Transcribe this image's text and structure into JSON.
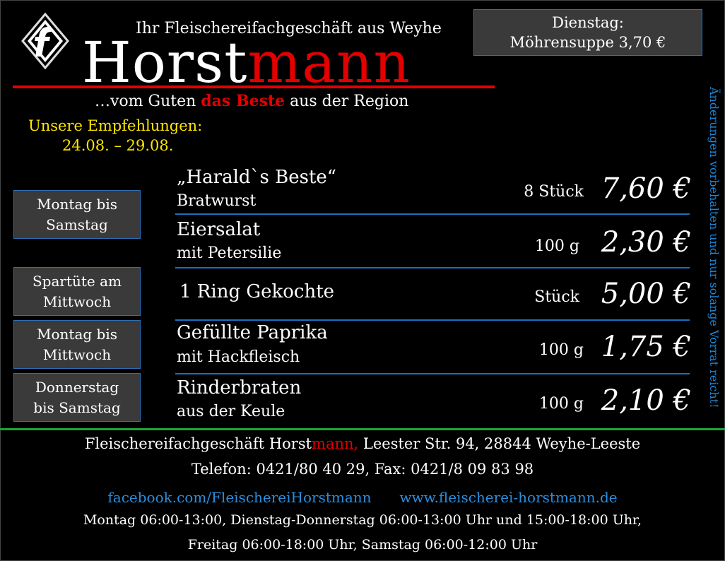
{
  "logo": {
    "icon": "fleischerei-f-logo"
  },
  "header": {
    "tagline": "Ihr Fleischereifachgeschäft aus Weyhe",
    "brand_white": "Horst",
    "brand_red": "mann",
    "slogan_pre": "…vom Guten ",
    "slogan_bold": "das Beste",
    "slogan_post": " aus der Region"
  },
  "recommendations": {
    "title": "Unsere Empfehlungen:",
    "dates": "24.08. – 29.08."
  },
  "special": {
    "day": "Dienstag:",
    "item": "Möhrensuppe 3,70 €"
  },
  "disclaimer": "Änderungen vorbehalten und nur solange Vorrat reicht!",
  "info_boxes": [
    {
      "line1": "Montag bis",
      "line2": "Samstag"
    },
    {
      "line1": "Spartüte am",
      "line2": "Mittwoch"
    },
    {
      "line1": "Montag bis",
      "line2": "Mittwoch"
    },
    {
      "line1": "Donnerstag",
      "line2": "bis Samstag"
    }
  ],
  "products": [
    {
      "name": "„Harald`s Beste“",
      "sub": "Bratwurst",
      "qty": "8 Stück",
      "price": "7,60 €"
    },
    {
      "name": "Eiersalat",
      "sub": "mit Petersilie",
      "qty": "100 g",
      "price": "2,30 €"
    },
    {
      "name": "1 Ring Gekochte",
      "sub": "",
      "qty": "Stück",
      "price": "5,00 €"
    },
    {
      "name": "Gefüllte Paprika",
      "sub": "mit Hackfleisch",
      "qty": "100 g",
      "price": "1,75 €"
    },
    {
      "name": "Rinderbraten",
      "sub": "aus der Keule",
      "qty": "100 g",
      "price": "2,10 €"
    }
  ],
  "footer": {
    "address_pre": "Fleischereifachgeschäft Horst",
    "address_red": "mann,",
    "address_post": " Leester Str. 94, 28844 Weyhe-Leeste",
    "phone": "Telefon: 0421/80 40 29, Fax: 0421/8 09 83 98",
    "facebook": "facebook.com/FleischereiHorstmann",
    "website": "www.fleischerei-horstmann.de",
    "hours1": "Montag 06:00-13:00, Dienstag-Donnerstag 06:00-13:00 Uhr und 15:00-18:00 Uhr,",
    "hours2": "Freitag 06:00-18:00 Uhr, Samstag 06:00-12:00 Uhr"
  },
  "colors": {
    "brand_red": "#e30000",
    "accent_blue": "#1e88d8",
    "highlight_yellow": "#ffe600",
    "divider_green": "#19a53a"
  }
}
